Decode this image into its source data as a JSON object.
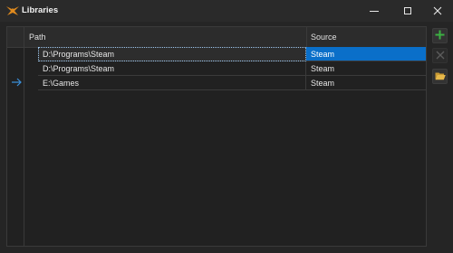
{
  "window": {
    "title": "Libraries",
    "controls": [
      "minimize",
      "maximize",
      "close"
    ]
  },
  "grid": {
    "columns": {
      "path": "Path",
      "source": "Source"
    },
    "rows": [
      {
        "path": "D:\\Programs\\Steam",
        "source": "Steam",
        "selected": true
      },
      {
        "path": "D:\\Programs\\Steam",
        "source": "Steam",
        "selected": false
      },
      {
        "path": "E:\\Games",
        "source": "Steam",
        "selected": false
      }
    ]
  },
  "toolbar": {
    "add_icon": "plus-icon",
    "remove_icon": "x-icon",
    "browse_icon": "folder-open-icon"
  },
  "colors": {
    "background": "#252525",
    "selection": "#0a6fc9",
    "add_green": "#3cb043",
    "folder_yellow": "#e6b84a",
    "app_icon_orange": "#e08a1e"
  }
}
